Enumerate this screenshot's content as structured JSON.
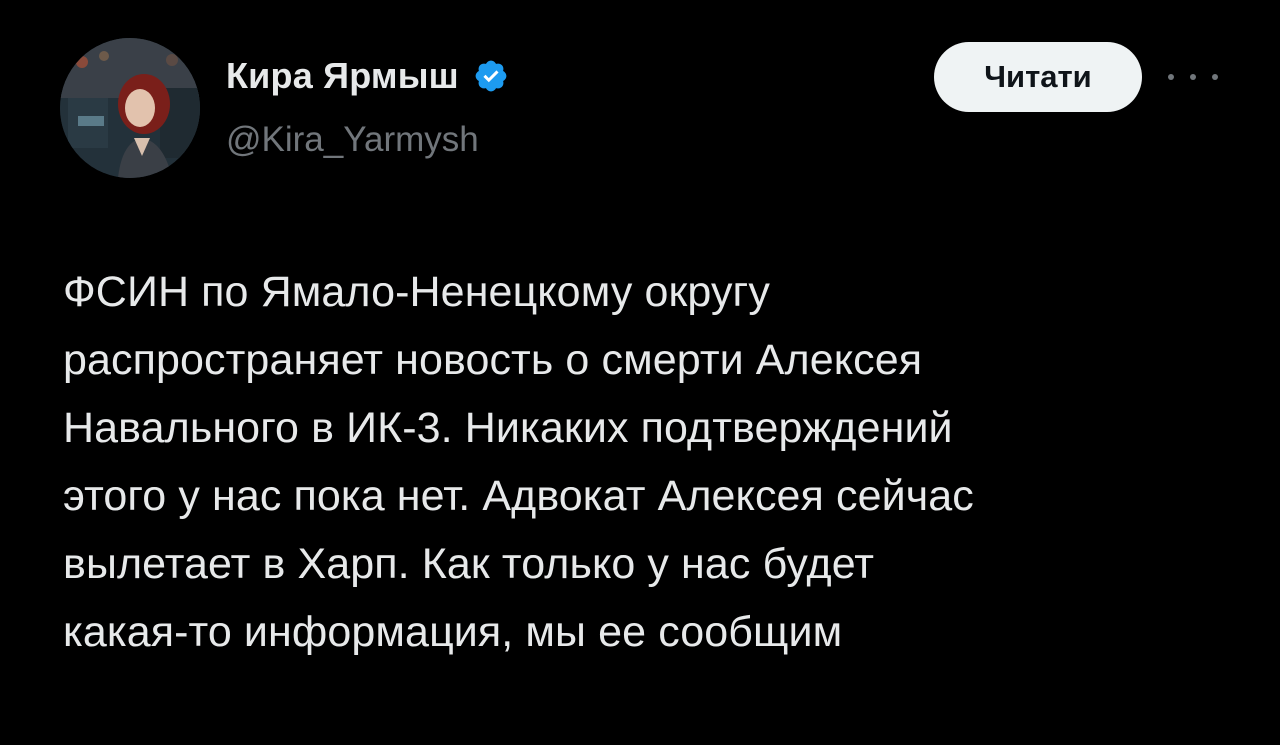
{
  "author": {
    "display_name": "Кира Ярмыш",
    "handle": "@Kira_Yarmysh",
    "verified_icon": "verified-badge-icon",
    "avatar_icon": "avatar-photo"
  },
  "header": {
    "read_label": "Читати",
    "more_icon": "more-horizontal-icon"
  },
  "tweet": {
    "text": "ФСИН по Ямало-Ненецкому округу\nраспространяет новость о смерти Алексея\nНавального в ИК-3. Никаких подтверждений\nэтого у нас пока нет. Адвокат Алексея сейчас\nвылетает в Харп. Как только у нас будет\nкакая-то информация, мы ее сообщим"
  },
  "colors": {
    "background": "#000000",
    "primary_text": "#e7e9ea",
    "secondary_text": "#71767b",
    "verified_blue": "#1d9bf0",
    "button_bg": "#eff3f4"
  }
}
